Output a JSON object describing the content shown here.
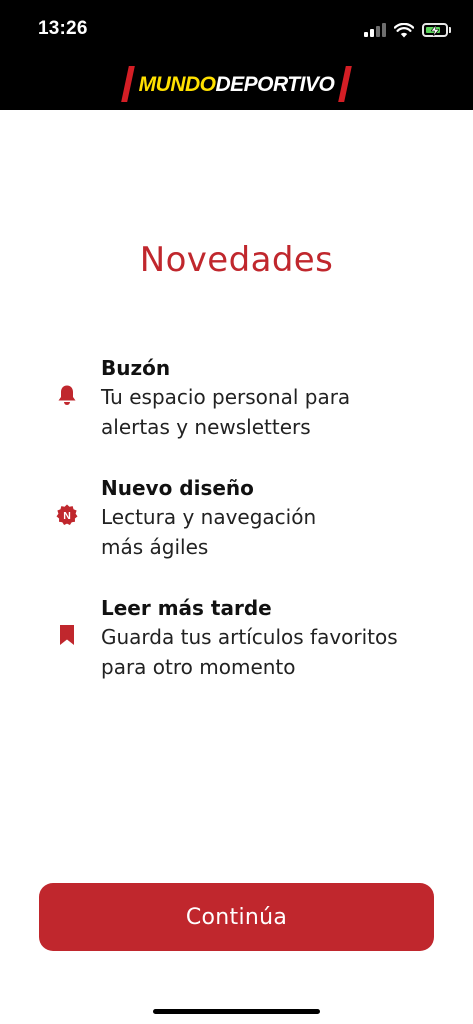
{
  "status_bar": {
    "time": "13:26",
    "icons": [
      "signal-icon",
      "wifi-icon",
      "battery-charging-icon"
    ]
  },
  "brand": {
    "logo_part1": "MUNDO",
    "logo_part2": "DEPORTIVO",
    "colors": {
      "part1": "#ffe000",
      "part2": "#ffffff",
      "stripe": "#d41e25"
    }
  },
  "title": "Novedades",
  "features": [
    {
      "icon": "bell-icon",
      "heading": "Buzón",
      "line1": "Tu espacio personal para",
      "line2": "alertas y newsletters"
    },
    {
      "icon": "new-badge-icon",
      "heading": "Nuevo diseño",
      "line1": "Lectura y navegación",
      "line2": "más ágiles"
    },
    {
      "icon": "bookmark-icon",
      "heading": "Leer más tarde",
      "line1": "Guarda tus artículos favoritos",
      "line2": "para otro momento"
    }
  ],
  "continue_label": "Continúa",
  "colors": {
    "accent": "#c0272d",
    "header_bg": "#000000",
    "background": "#ffffff"
  }
}
